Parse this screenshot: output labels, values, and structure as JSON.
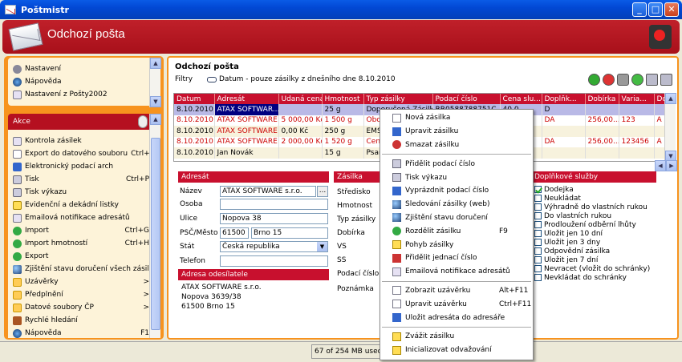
{
  "window": {
    "title": "Poštmistr"
  },
  "banner": {
    "title": "Odchozí pošta"
  },
  "sidebar": {
    "top_items": [
      {
        "label": "Nastavení"
      },
      {
        "label": "Nápověda"
      },
      {
        "label": "Nastavení z Pošty2002"
      }
    ],
    "akce_title": "Akce",
    "akce_items": [
      {
        "label": "Kontrola zásilek",
        "shortcut": ""
      },
      {
        "label": "Export do datového souboru",
        "shortcut": "Ctrl+E"
      },
      {
        "label": "Elektronický podací arch",
        "shortcut": ""
      },
      {
        "label": "Tisk",
        "shortcut": "Ctrl+P"
      },
      {
        "label": "Tisk výkazu",
        "shortcut": ""
      },
      {
        "label": "Evidenční a dekádní listky",
        "shortcut": ""
      },
      {
        "label": "Emailová notifikace adresátů",
        "shortcut": ""
      },
      {
        "label": "Import",
        "shortcut": "Ctrl+G"
      },
      {
        "label": "Import hmotností",
        "shortcut": "Ctrl+H"
      },
      {
        "label": "Export",
        "shortcut": ""
      },
      {
        "label": "Zjištění stavu doručení všech zásilek",
        "shortcut": ""
      },
      {
        "label": "Uzávěrky",
        "shortcut": ">"
      },
      {
        "label": "Předplnění",
        "shortcut": ">"
      },
      {
        "label": "Datové soubory ČP",
        "shortcut": ">"
      },
      {
        "label": "Rychlé hledání",
        "shortcut": ""
      },
      {
        "label": "Nápověda",
        "shortcut": "F1"
      }
    ]
  },
  "main": {
    "title": "Odchozí pošta",
    "filter_label": "Filtry",
    "filter_text": "Datum - pouze zásilky z dnešního dne 8.10.2010"
  },
  "table": {
    "headers": [
      "Datum",
      "Adresát",
      "Udaná cena",
      "Hmotnost",
      "Typ zásilky",
      "Podací číslo",
      "Cena slu...",
      "Doplňk...",
      "Dobírka",
      "Varia...",
      "Dob"
    ],
    "rows": [
      [
        "8.10.2010",
        "ATAX SOFTWAR...",
        "",
        "25 g",
        "Doporučená Zásilka",
        "RR0588788751C",
        "40,0",
        "D",
        "",
        "",
        ""
      ],
      [
        "8.10.2010",
        "ATAX SOFTWARE ...",
        "5 000,00 Kč",
        "1 500 g",
        "Obch",
        "",
        "",
        "DA",
        "256,00...",
        "123",
        "A"
      ],
      [
        "8.10.2010",
        "ATAX SOFTWARE ...",
        "0,00 Kč",
        "250 g",
        "EMS",
        "",
        "",
        "",
        "",
        "",
        ""
      ],
      [
        "8.10.2010",
        "ATAX SOFTWARE ...",
        "2 000,00 Kč",
        "1 520 g",
        "Cenn",
        "",
        "",
        "DA",
        "256,00...",
        "123456",
        "A"
      ],
      [
        "8.10.2010",
        "Jan Novák",
        "",
        "15 g",
        "Psan",
        "",
        "",
        "",
        "",
        "",
        ""
      ]
    ]
  },
  "adresat": {
    "section": "Adresát",
    "fields": [
      {
        "label": "Název",
        "value": "ATAX SOFTWARE s.r.o."
      },
      {
        "label": "Osoba",
        "value": ""
      },
      {
        "label": "Ulice",
        "value": "Nopova 38"
      },
      {
        "label": "PSČ/Město",
        "psc": "61500",
        "city": "Brno 15"
      },
      {
        "label": "Stát",
        "value": "Česká republika"
      },
      {
        "label": "Telefon",
        "value": ""
      }
    ],
    "dots": "..."
  },
  "odesilatel": {
    "section": "Adresa odesílatele",
    "lines": [
      "ATAX SOFTWARE s.r.o.",
      "Nopova 3639/38",
      "61500 Brno 15"
    ]
  },
  "zasilka": {
    "section": "Zásilka",
    "labels": [
      "Středisko",
      "Hmotnost",
      "Typ zásilky",
      "Dobírka",
      "VS",
      "SS",
      "Podací číslo",
      "Poznámka"
    ]
  },
  "doplnkove": {
    "section": "Doplňkové služby",
    "items": [
      {
        "label": "Dodejka",
        "checked": true
      },
      {
        "label": "Neukládat",
        "checked": false
      },
      {
        "label": "Výhradně do vlastních rukou",
        "checked": false
      },
      {
        "label": "Do vlastních rukou",
        "checked": false
      },
      {
        "label": "Prodloužení odběrní lhůty",
        "checked": false
      },
      {
        "label": "Uložit jen 10 dní",
        "checked": false
      },
      {
        "label": "Uložit jen 3 dny",
        "checked": false
      },
      {
        "label": "Odpovědní zásilka",
        "checked": false
      },
      {
        "label": "Uložit jen 7 dní",
        "checked": false
      },
      {
        "label": "Nevracet (vložit do schránky)",
        "checked": false
      },
      {
        "label": "Nevkládat do schránky",
        "checked": false
      }
    ]
  },
  "context_menu": {
    "groups": [
      [
        {
          "label": "Nová zásilka",
          "shortcut": "",
          "icon": "new-document-icon"
        },
        {
          "label": "Upravit zásilku",
          "shortcut": "",
          "icon": "edit-icon"
        },
        {
          "label": "Smazat zásilku",
          "shortcut": "",
          "icon": "delete-icon"
        }
      ],
      [
        {
          "label": "Přidělit podací číslo",
          "shortcut": "",
          "icon": "barcode-icon"
        },
        {
          "label": "Tisk výkazu",
          "shortcut": "",
          "icon": "print-icon"
        },
        {
          "label": "Vyprázdnit podací číslo",
          "shortcut": "",
          "icon": "eraser-icon"
        },
        {
          "label": "Sledování zásilky (web)",
          "shortcut": "",
          "icon": "web-icon"
        },
        {
          "label": "Zjištění stavu doručení",
          "shortcut": "",
          "icon": "globe-icon"
        },
        {
          "label": "Rozdělit zásilku",
          "shortcut": "F9",
          "icon": "split-icon"
        },
        {
          "label": "Pohyb zásilky",
          "shortcut": "",
          "icon": "package-icon"
        },
        {
          "label": "Přidělit jednací číslo",
          "shortcut": "",
          "icon": "person-icon"
        },
        {
          "label": "Emailová notifikace adresátů",
          "shortcut": "",
          "icon": "mail-icon"
        }
      ],
      [
        {
          "label": "Zobrazit uzávěrku",
          "shortcut": "Alt+F11",
          "icon": "view-icon"
        },
        {
          "label": "Upravit uzávěrku",
          "shortcut": "Ctrl+F11",
          "icon": "edit-closing-icon"
        },
        {
          "label": "Uložit adresáta do adresáře",
          "shortcut": "",
          "icon": "addressbook-icon"
        }
      ],
      [
        {
          "label": "Zvážit zásilku",
          "shortcut": "",
          "icon": "scale-icon"
        },
        {
          "label": "Inicializovat odvažování",
          "shortcut": "",
          "icon": "scale-init-icon"
        }
      ]
    ]
  },
  "status": {
    "memory": "67 of 254 MB used, r"
  }
}
